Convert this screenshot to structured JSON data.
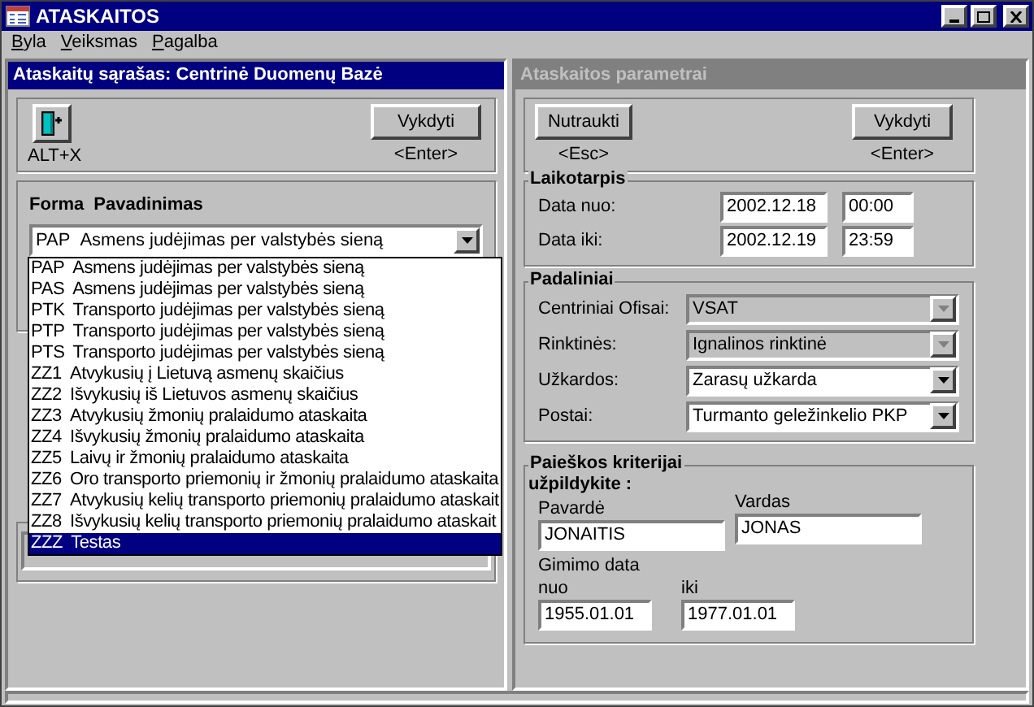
{
  "window": {
    "title": "ATASKAITOS"
  },
  "menu": [
    "Byla",
    "Veiksmas",
    "Pagalba"
  ],
  "report_list_panel": {
    "title": "Ataskaitų sąrašas: Centrinė Duomenų Bazė",
    "active": true,
    "exit_button": {
      "shortcut": "ALT+X"
    },
    "run_button": {
      "label": "Vykdyti",
      "shortcut": "<Enter>"
    },
    "list_header": [
      "Forma",
      "Pavadinimas"
    ],
    "report_combo": {
      "code": "PAP",
      "name": "Asmens judėjimas per valstybės sieną"
    },
    "dropdown_items": [
      {
        "code": "PAP",
        "name": "Asmens judėjimas per valstybės sieną",
        "selected": false
      },
      {
        "code": "PAS",
        "name": "Asmens judėjimas per valstybės sieną",
        "selected": false
      },
      {
        "code": "PTK",
        "name": "Transporto judėjimas per valstybės sieną",
        "selected": false
      },
      {
        "code": "PTP",
        "name": "Transporto judėjimas per valstybės sieną",
        "selected": false
      },
      {
        "code": "PTS",
        "name": "Transporto judėjimas per valstybės sieną",
        "selected": false
      },
      {
        "code": "ZZ1",
        "name": "Atvykusių į Lietuvą asmenų skaičius",
        "selected": false
      },
      {
        "code": "ZZ2",
        "name": "Išvykusių iš Lietuvos asmenų skaičius",
        "selected": false
      },
      {
        "code": "ZZ3",
        "name": "Atvykusių žmonių pralaidumo ataskaita",
        "selected": false
      },
      {
        "code": "ZZ4",
        "name": "Išvykusių žmonių pralaidumo ataskaita",
        "selected": false
      },
      {
        "code": "ZZ5",
        "name": "Laivų ir žmonių pralaidumo ataskaita",
        "selected": false
      },
      {
        "code": "ZZ6",
        "name": "Oro transporto priemonių ir žmonių pralaidumo ataskaita",
        "selected": false
      },
      {
        "code": "ZZ7",
        "name": "Atvykusių kelių transporto priemonių pralaidumo ataskait",
        "selected": false
      },
      {
        "code": "ZZ8",
        "name": "Išvykusių kelių transporto priemonių pralaidumo ataskait",
        "selected": false
      },
      {
        "code": "ZZZ",
        "name": "Testas",
        "selected": true
      }
    ]
  },
  "parameters_panel": {
    "title": "Ataskaitos parametrai",
    "active": false,
    "cancel_button": {
      "label": "Nutraukti",
      "shortcut": "<Esc>"
    },
    "run_button": {
      "label": "Vykdyti",
      "shortcut": "<Enter>"
    },
    "period": {
      "title": "Laikotarpis",
      "rows": [
        {
          "label": "Data nuo:",
          "date": "2002.12.18",
          "time": "00:00"
        },
        {
          "label": "Data iki:",
          "date": "2002.12.19",
          "time": "23:59"
        }
      ]
    },
    "units": {
      "title": "Padaliniai",
      "rows": [
        {
          "label": "Centriniai Ofisai:",
          "value": "VSAT",
          "disabled": true
        },
        {
          "label": "Rinktinės:",
          "value": "Ignalinos rinktinė",
          "disabled": true
        },
        {
          "label": "Užkardos:",
          "value": "Zarasų užkarda",
          "disabled": false
        },
        {
          "label": "Postai:",
          "value": "Turmanto geležinkelio PKP",
          "disabled": false
        }
      ]
    },
    "search": {
      "title": "Paieškos kriterijai",
      "subtitle": "užpildykite :",
      "surname": {
        "label": "Pavardė",
        "value": "JONAITIS"
      },
      "name": {
        "label": "Vardas",
        "value": "JONAS"
      },
      "birth_date": {
        "label": "Gimimo data",
        "from": {
          "label": "nuo",
          "value": "1955.01.01"
        },
        "to": {
          "label": "iki",
          "value": "1977.01.01"
        }
      }
    }
  }
}
